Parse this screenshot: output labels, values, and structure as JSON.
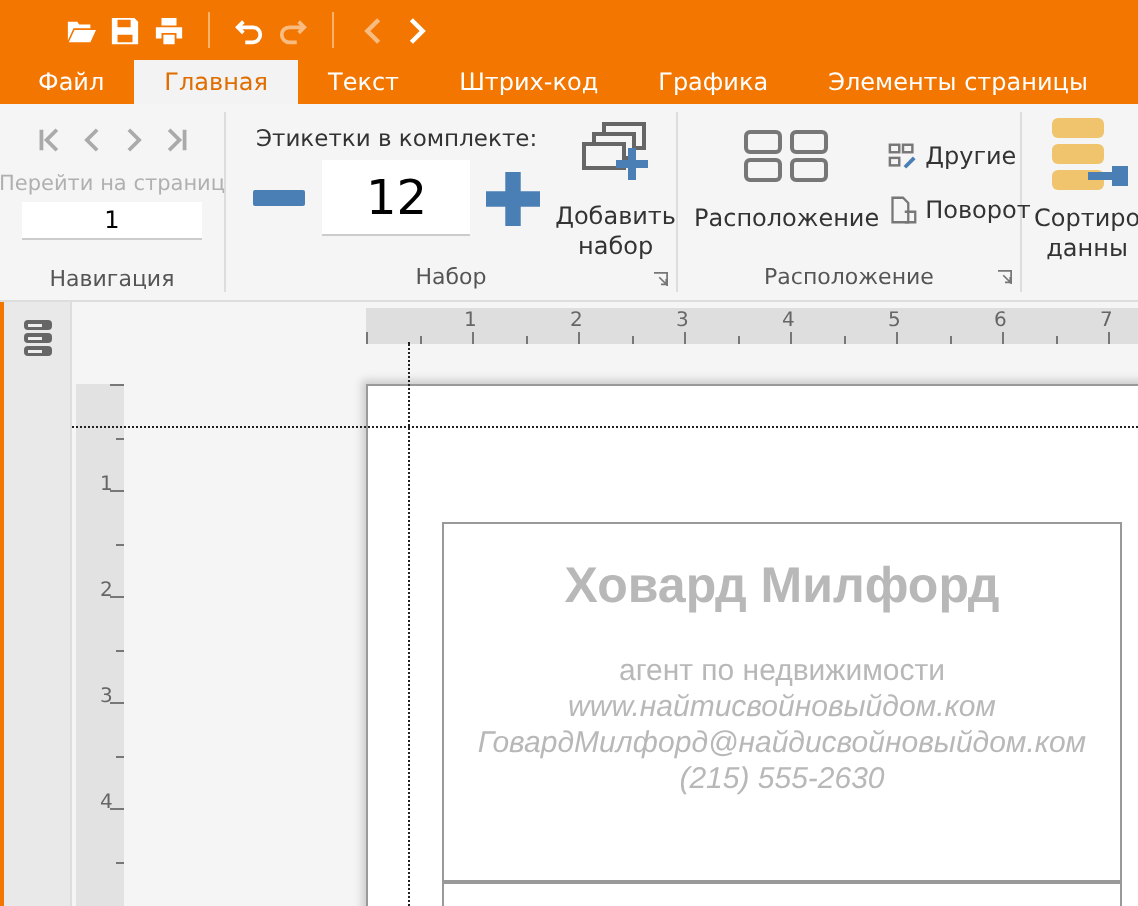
{
  "quick_access": [
    [
      {
        "kind": "open",
        "disabled": false
      },
      {
        "kind": "save",
        "disabled": false
      },
      {
        "kind": "print",
        "disabled": false
      }
    ],
    [
      {
        "kind": "undo",
        "disabled": false
      },
      {
        "kind": "redo",
        "disabled": true
      }
    ],
    [
      {
        "kind": "back",
        "disabled": true
      },
      {
        "kind": "forward",
        "disabled": false
      }
    ]
  ],
  "tabs": [
    {
      "label": "Файл",
      "selected": false
    },
    {
      "label": "Главная",
      "selected": true
    },
    {
      "label": "Текст",
      "selected": false
    },
    {
      "label": "Штрих-код",
      "selected": false
    },
    {
      "label": "Графика",
      "selected": false
    },
    {
      "label": "Элементы страницы",
      "selected": false
    }
  ],
  "ribbon": {
    "navigation": {
      "buttons": [
        {
          "kind": "first",
          "disabled": true
        },
        {
          "kind": "prev",
          "disabled": true
        },
        {
          "kind": "next",
          "disabled": true
        },
        {
          "kind": "last",
          "disabled": true
        }
      ],
      "goto_label": "Перейти на страниц",
      "goto_disabled": true,
      "page_value": "1",
      "group_label": "Навигация"
    },
    "set": {
      "label": "Этикетки в комплекте:",
      "value": "12",
      "add_button": [
        "Добавить",
        "набор"
      ],
      "group_label": "Набор"
    },
    "layout": {
      "big_button": "Расположение",
      "others_button": "Другие",
      "rotate_button": "Поворот",
      "group_label": "Расположение"
    },
    "sort_button": [
      "Сортиро",
      "данны"
    ]
  },
  "rulers": {
    "horizontal": [
      "1",
      "2",
      "3",
      "4",
      "5",
      "6",
      "7"
    ],
    "vertical": [
      "1",
      "2",
      "3",
      "4"
    ]
  },
  "label": {
    "name": "Ховард Милфорд",
    "title": "агент по недвижимости",
    "website": "www.найтисвойновыйдом.ком",
    "email": "ГовардМилфорд@найдисвойновыйдом.ком",
    "phone": "(215) 555-2630"
  }
}
